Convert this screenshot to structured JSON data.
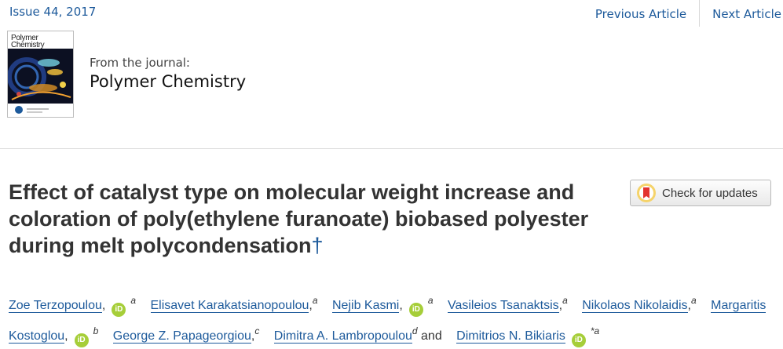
{
  "header": {
    "issue": "Issue 44, 2017",
    "nav": {
      "previous": "Previous Article",
      "next": "Next Article"
    }
  },
  "journal": {
    "cover_title": "Polymer Chemistry",
    "from_label": "From the journal:",
    "name": "Polymer Chemistry"
  },
  "article": {
    "title": "Effect of catalyst type on molecular weight increase and coloration of poly(ethylene furanoate) biobased polyester during melt polycondensation",
    "dagger": "†",
    "check_updates_label": "Check for updates",
    "orcid_text": "iD",
    "authors": [
      {
        "name": "Zoe Terzopoulou",
        "orcid": true,
        "aff": "a",
        "sep": ","
      },
      {
        "name": "Elisavet Karakatsianopoulou",
        "orcid": false,
        "aff": "a",
        "sep": ","
      },
      {
        "name": "Nejib Kasmi",
        "orcid": true,
        "aff": "a",
        "sep": ","
      },
      {
        "name": "Vasileios Tsanaktsis",
        "orcid": false,
        "aff": "a",
        "sep": ","
      },
      {
        "name": "Nikolaos Nikolaidis",
        "orcid": false,
        "aff": "a",
        "sep": ","
      },
      {
        "name": "Margaritis Kostoglou",
        "orcid": true,
        "aff": "b",
        "sep": ","
      },
      {
        "name": "George Z. Papageorgiou",
        "orcid": false,
        "aff": "c",
        "sep": ","
      },
      {
        "name": "Dimitra A. Lambropoulou",
        "orcid": false,
        "aff": "d",
        "sep": " and"
      },
      {
        "name": "Dimitrios N. Bikiaris",
        "orcid": true,
        "aff": "*a",
        "sep": ""
      }
    ]
  },
  "colors": {
    "link": "#1d5a9b",
    "orcid": "#a6ce39",
    "title": "#333333"
  },
  "icons": {
    "orcid": "orcid-icon",
    "updates": "check-for-updates-icon"
  }
}
